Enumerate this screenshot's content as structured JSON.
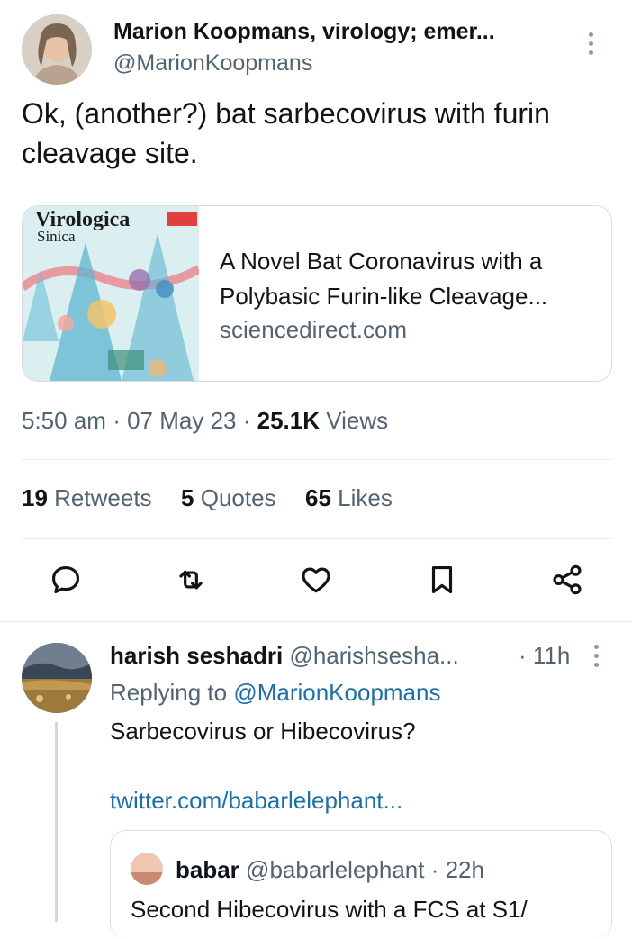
{
  "tweet": {
    "author_name": "Marion Koopmans, virology; emer...",
    "author_handle": "@MarionKoopmans",
    "text": "Ok, (another?) bat sarbecovirus with furin cleavage site.",
    "link_card": {
      "thumb_title": "Virologica",
      "thumb_subtitle": "Sinica",
      "title": "A Novel Bat Coronavirus with a Polybasic Furin-like Cleavage...",
      "domain": "sciencedirect.com"
    },
    "time": "5:50 am",
    "date": "07 May 23",
    "views_count": "25.1K",
    "views_label": "Views",
    "stats": {
      "retweets_count": "19",
      "retweets_label": "Retweets",
      "quotes_count": "5",
      "quotes_label": "Quotes",
      "likes_count": "65",
      "likes_label": "Likes"
    },
    "actions": [
      "reply-icon",
      "retweet-icon",
      "like-icon",
      "bookmark-icon",
      "share-icon"
    ]
  },
  "reply": {
    "author_name": "harish seshadri",
    "author_handle": "@harishsesha...",
    "time": "· 11h",
    "replying_to_label": "Replying to",
    "replying_to_handle": "@MarionKoopmans",
    "text": "Sarbecovirus or Hibecovirus?",
    "link": "twitter.com/babarlelephant...",
    "quoted": {
      "author_name": "babar",
      "author_handle": "@babarlelephant",
      "time": "· 22h",
      "text": "Second Hibecovirus with a FCS at S1/"
    }
  },
  "colors": {
    "link": "#1d6fa5",
    "muted": "#536471",
    "text": "#0f1419"
  }
}
